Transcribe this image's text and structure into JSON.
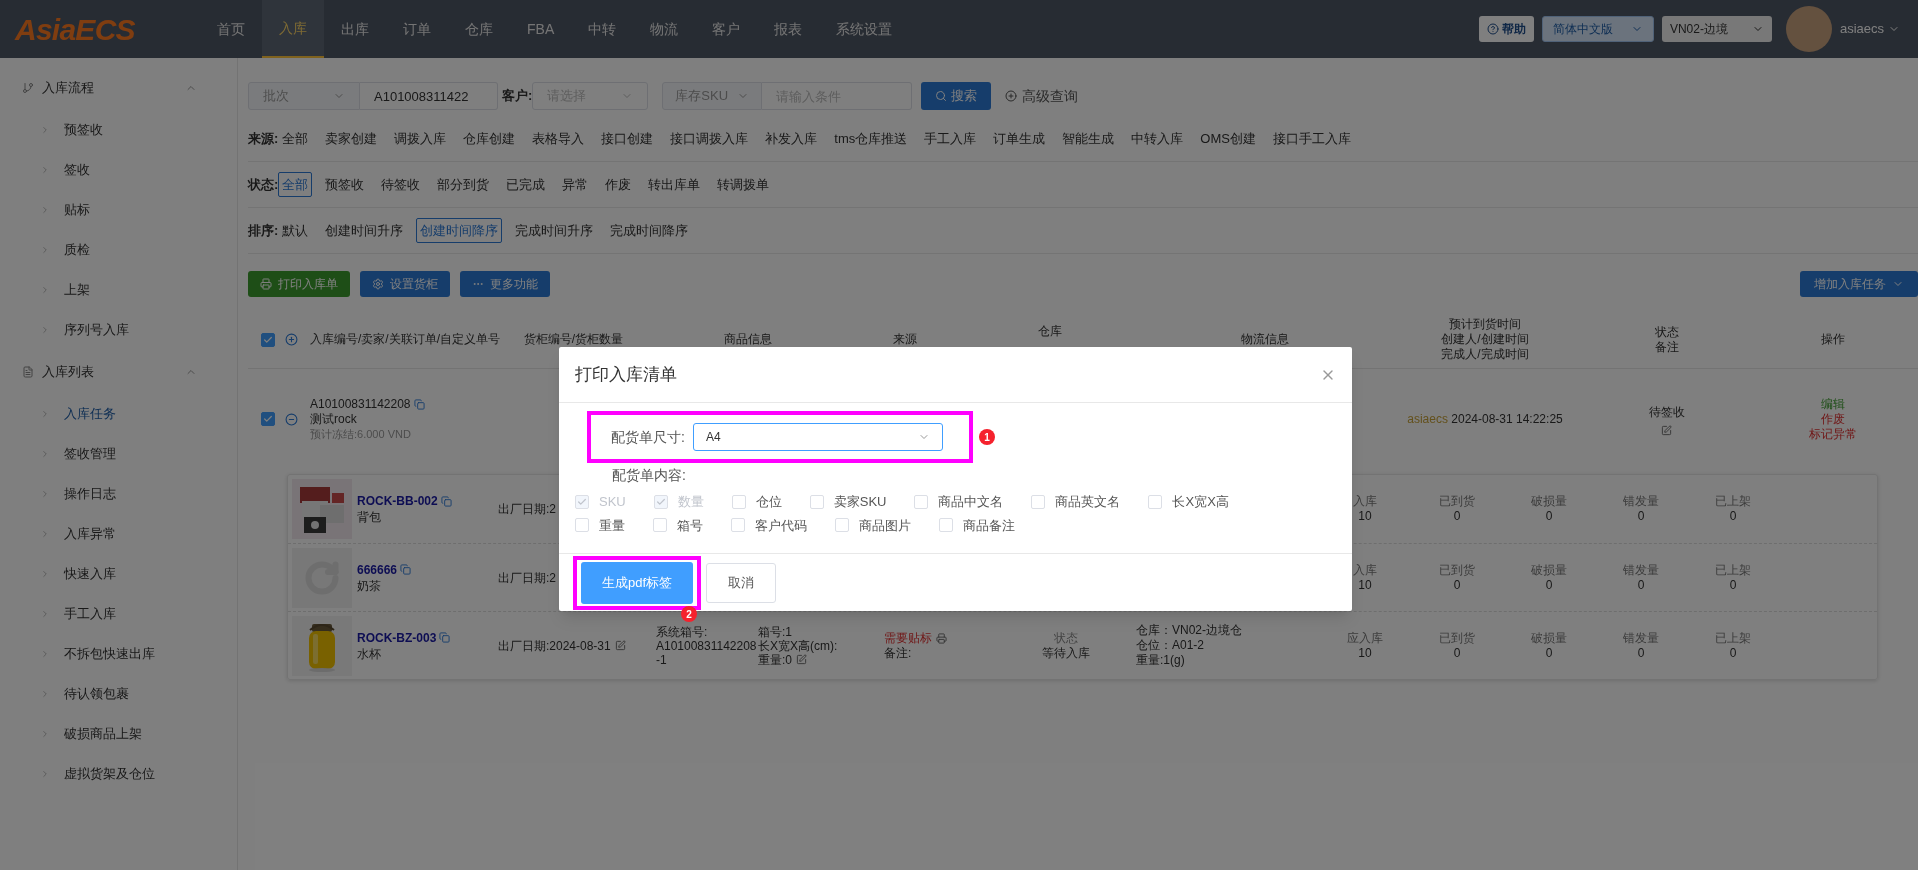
{
  "logo": "AsiaECS",
  "nav": [
    {
      "label": "首页",
      "selected": false
    },
    {
      "label": "入库",
      "selected": true
    },
    {
      "label": "出库",
      "selected": false
    },
    {
      "label": "订单",
      "selected": false
    },
    {
      "label": "仓库",
      "selected": false
    },
    {
      "label": "FBA",
      "selected": false
    },
    {
      "label": "中转",
      "selected": false
    },
    {
      "label": "物流",
      "selected": false
    },
    {
      "label": "客户",
      "selected": false
    },
    {
      "label": "报表",
      "selected": false
    },
    {
      "label": "系统设置",
      "selected": false
    }
  ],
  "header": {
    "help": "帮助",
    "language": "简体中文版",
    "warehouse": "VN02-边境",
    "user": "asiaecs"
  },
  "sidebar": [
    {
      "label": "入库流程",
      "kind": "flow",
      "expanded": true,
      "children": [
        {
          "label": "预签收",
          "selected": false
        },
        {
          "label": "签收",
          "selected": false
        },
        {
          "label": "贴标",
          "selected": false
        },
        {
          "label": "质检",
          "selected": false
        },
        {
          "label": "上架",
          "selected": false
        },
        {
          "label": "序列号入库",
          "selected": false
        }
      ]
    },
    {
      "label": "入库列表",
      "kind": "list",
      "expanded": true,
      "children": [
        {
          "label": "入库任务",
          "selected": true
        },
        {
          "label": "签收管理",
          "selected": false
        },
        {
          "label": "操作日志",
          "selected": false
        },
        {
          "label": "入库异常",
          "selected": false
        },
        {
          "label": "快速入库",
          "selected": false
        },
        {
          "label": "手工入库",
          "selected": false
        },
        {
          "label": "不拆包快速出库",
          "selected": false
        },
        {
          "label": "待认领包裹",
          "selected": false
        },
        {
          "label": "破损商品上架",
          "selected": false
        },
        {
          "label": "虚拟货架及仓位",
          "selected": false
        }
      ]
    }
  ],
  "search": {
    "batch_type": "批次",
    "batch_value": "A101008311422",
    "customer_label": "客户:",
    "customer_placeholder": "请选择",
    "sku_type": "库存SKU",
    "sku_placeholder": "请输入条件",
    "search_button": "搜索",
    "advanced": "高级查询"
  },
  "filters": [
    {
      "label": "来源:",
      "options": [
        {
          "label": "全部",
          "selected": false
        },
        {
          "label": "卖家创建",
          "selected": false
        },
        {
          "label": "调拨入库",
          "selected": false
        },
        {
          "label": "仓库创建",
          "selected": false
        },
        {
          "label": "表格导入",
          "selected": false
        },
        {
          "label": "接口创建",
          "selected": false
        },
        {
          "label": "接口调拨入库",
          "selected": false
        },
        {
          "label": "补发入库",
          "selected": false
        },
        {
          "label": "tms仓库推送",
          "selected": false
        },
        {
          "label": "手工入库",
          "selected": false
        },
        {
          "label": "订单生成",
          "selected": false
        },
        {
          "label": "智能生成",
          "selected": false
        },
        {
          "label": "中转入库",
          "selected": false
        },
        {
          "label": "OMS创建",
          "selected": false
        },
        {
          "label": "接口手工入库",
          "selected": false
        }
      ]
    },
    {
      "label": "状态:",
      "options": [
        {
          "label": "全部",
          "selected": true
        },
        {
          "label": "预签收",
          "selected": false
        },
        {
          "label": "待签收",
          "selected": false
        },
        {
          "label": "部分到货",
          "selected": false
        },
        {
          "label": "已完成",
          "selected": false
        },
        {
          "label": "异常",
          "selected": false
        },
        {
          "label": "作废",
          "selected": false
        },
        {
          "label": "转出库单",
          "selected": false
        },
        {
          "label": "转调拨单",
          "selected": false
        }
      ]
    },
    {
      "label": "排序:",
      "options": [
        {
          "label": "默认",
          "selected": false
        },
        {
          "label": "创建时间升序",
          "selected": false
        },
        {
          "label": "创建时间降序",
          "selected": true
        },
        {
          "label": "完成时间升序",
          "selected": false
        },
        {
          "label": "完成时间降序",
          "selected": false
        }
      ]
    }
  ],
  "actions": [
    {
      "label": "打印入库单",
      "kind": "print"
    },
    {
      "label": "设置货柜",
      "kind": "settings"
    },
    {
      "label": "更多功能",
      "kind": "more"
    }
  ],
  "add_task": "增加入库任务",
  "table": {
    "checked": true,
    "columns": [
      {
        "lines": [
          "入库编号/卖家/关联订单/自定义单号"
        ]
      },
      {
        "lines": [
          "货柜编号/货柜数量"
        ]
      },
      {
        "lines": [
          "商品信息"
        ]
      },
      {
        "lines": [
          "来源"
        ]
      },
      {
        "lines": [
          "仓库"
        ]
      },
      {
        "lines": [
          "物流信息"
        ]
      },
      {
        "lines": [
          "预计到货时间",
          "创建人/创建时间",
          "完成人/完成时间"
        ]
      },
      {
        "lines": [
          "状态",
          "备注"
        ]
      },
      {
        "lines": [
          "操作"
        ]
      }
    ],
    "rows": [
      {
        "checked": true,
        "expanded": true,
        "number": "A10100831142208",
        "seller": "测试rock",
        "frozen": "预计冻结:6.000 VND",
        "creator": "asiaecs",
        "created": "2024-08-31 14:22:25",
        "status": "待签收",
        "actions": [
          {
            "label": "编辑",
            "kind": "edit"
          },
          {
            "label": "作废",
            "kind": "danger"
          },
          {
            "label": "标记异常",
            "kind": "danger"
          }
        ],
        "items": [
          {
            "sku": "ROCK-BB-002",
            "name": "背包",
            "date": "出厂日期:2",
            "quantities": [
              {
                "label": "入库",
                "value": "10"
              },
              {
                "label": "已到货",
                "value": "0"
              },
              {
                "label": "破损量",
                "value": "0"
              },
              {
                "label": "错发量",
                "value": "0"
              },
              {
                "label": "已上架",
                "value": "0"
              }
            ]
          },
          {
            "kind": "placeholder",
            "sku": "666666",
            "name": "奶茶",
            "date": "出厂日期:2",
            "quantities": [
              {
                "label": "入库",
                "value": "10"
              },
              {
                "label": "已到货",
                "value": "0"
              },
              {
                "label": "破损量",
                "value": "0"
              },
              {
                "label": "错发量",
                "value": "0"
              },
              {
                "label": "已上架",
                "value": "0"
              }
            ]
          },
          {
            "sku": "ROCK-BZ-003",
            "name": "水杯",
            "date": "出厂日期:2024-08-31",
            "box_no_label": "系统箱号:",
            "box_no": "A10100831142208-1",
            "box": "箱号:1",
            "dims": "长X宽X高(cm):",
            "weight": "重量:0",
            "tag": "需要贴标",
            "remark": "备注:",
            "state_label": "状态",
            "state": "等待入库",
            "warehouse": "仓库：VN02-边境仓",
            "location": "仓位：A01-2",
            "item_weight": "重量:1(g)",
            "quantities": [
              {
                "label": "应入库",
                "value": "10"
              },
              {
                "label": "已到货",
                "value": "0"
              },
              {
                "label": "破损量",
                "value": "0"
              },
              {
                "label": "错发量",
                "value": "0"
              },
              {
                "label": "已上架",
                "value": "0"
              }
            ]
          }
        ]
      }
    ]
  },
  "modal": {
    "title": "打印入库清单",
    "size_label": "配货单尺寸:",
    "size_value": "A4",
    "content_label": "配货单内容:",
    "options": [
      {
        "label": "SKU",
        "checked": true,
        "disabled": true
      },
      {
        "label": "数量",
        "checked": true,
        "disabled": true
      },
      {
        "label": "仓位",
        "checked": false,
        "disabled": false
      },
      {
        "label": "卖家SKU",
        "checked": false,
        "disabled": false
      },
      {
        "label": "商品中文名",
        "checked": false,
        "disabled": false
      },
      {
        "label": "商品英文名",
        "checked": false,
        "disabled": false
      },
      {
        "label": "长X宽X高",
        "checked": false,
        "disabled": false
      },
      {
        "label": "重量",
        "checked": false,
        "disabled": false
      },
      {
        "label": "箱号",
        "checked": false,
        "disabled": false
      },
      {
        "label": "客户代码",
        "checked": false,
        "disabled": false
      },
      {
        "label": "商品图片",
        "checked": false,
        "disabled": false
      },
      {
        "label": "商品备注",
        "checked": false,
        "disabled": false
      }
    ],
    "primary": "生成pdf标签",
    "cancel": "取消",
    "markers": [
      "1",
      "2"
    ]
  }
}
